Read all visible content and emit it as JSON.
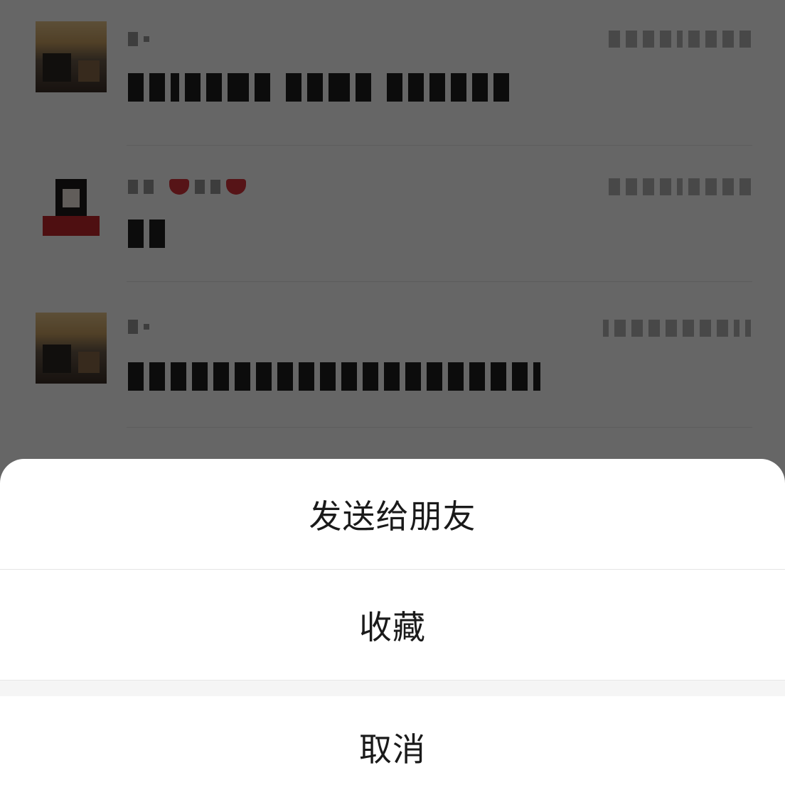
{
  "action_sheet": {
    "send_to_friend": "发送给朋友",
    "favorite": "收藏",
    "cancel": "取消"
  },
  "chat_list": {
    "rows": [
      {
        "avatar_icon": "landscape-photo-avatar",
        "name_blurred": true,
        "message_blurred": true
      },
      {
        "avatar_icon": "person-avatar",
        "name_blurred": true,
        "message_blurred": true
      },
      {
        "avatar_icon": "landscape-photo-avatar",
        "name_blurred": true,
        "message_blurred": true
      }
    ]
  },
  "colors": {
    "overlay": "rgba(0,0,0,0.6)",
    "sheet_background": "#ffffff",
    "text": "#1a1a1a",
    "group_gap": "#f5f5f5"
  }
}
